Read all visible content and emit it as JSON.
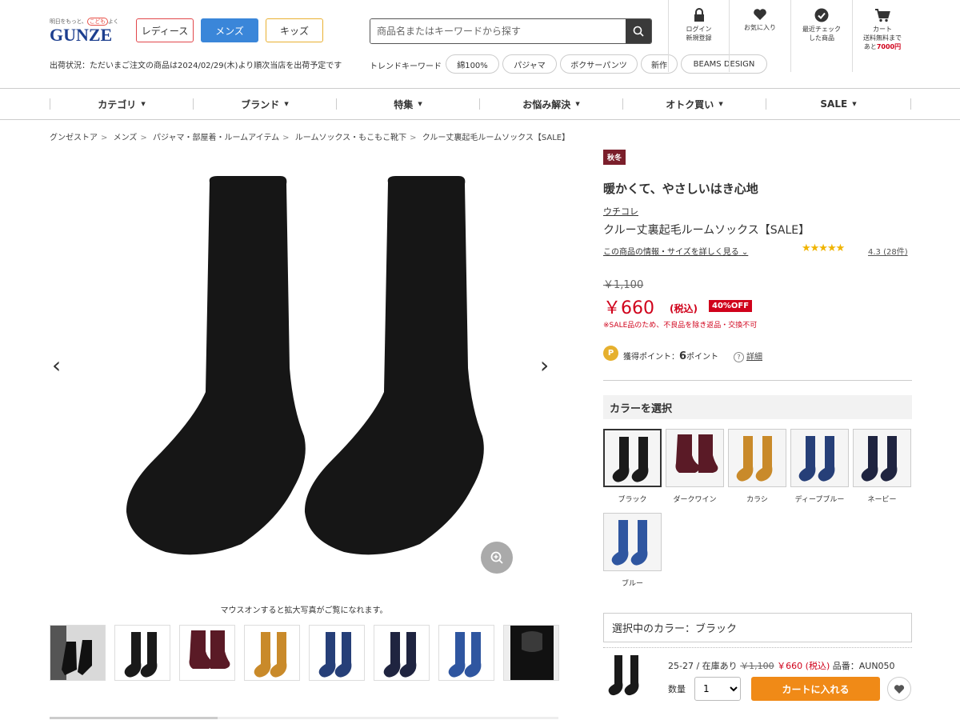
{
  "header": {
    "tagline_pre": "明日をもっと、",
    "tagline_kid": "こども",
    "tagline_post": "よく",
    "logo": "GUNZE",
    "gender_tabs": {
      "ladies": "レディース",
      "mens": "メンズ",
      "kids": "キッズ"
    },
    "ship_status": "出荷状況：ただいまご注文の商品は2024/02/29(木)より順次当店を出荷予定です",
    "search_placeholder": "商品名またはキーワードから探す",
    "trend_label": "トレンドキーワード",
    "trends": [
      "綿100%",
      "パジャマ",
      "ボクサーパンツ",
      "新作",
      "BEAMS DESIGN"
    ],
    "icons": {
      "login": {
        "line1": "ログイン",
        "line2": "新規登録"
      },
      "favorite": {
        "line1": "お気に入り"
      },
      "recent": {
        "line1": "最近チェック",
        "line2": "した商品"
      },
      "cart": {
        "line1": "カート",
        "line2": "送料無料まで",
        "line3_pre": "あと",
        "line3_amount": "7000円"
      }
    }
  },
  "nav": [
    "カテゴリ",
    "ブランド",
    "特集",
    "お悩み解決",
    "オトク買い",
    "SALE"
  ],
  "breadcrumb": [
    "グンゼストア",
    "メンズ",
    "パジャマ・部屋着・ルームアイテム",
    "ルームソックス・もこもこ靴下",
    "クルー丈裏起毛ルームソックス【SALE】"
  ],
  "gallery": {
    "zoom_note": "マウスオンすると拡大写真がご覧になれます。"
  },
  "product": {
    "season": "秋冬",
    "catch": "暖かくて、やさしいはき心地",
    "brand": "ウチコレ",
    "name": "クルー丈裏起毛ルームソックス【SALE】",
    "info_link": "この商品の情報・サイズを詳しく見る",
    "stars": "★★★★★",
    "rating": "4.3 (28件)",
    "old_price": "￥1,100",
    "price": "￥660",
    "tax_label": "(税込)",
    "discount": "40%OFF",
    "sale_note": "※SALE品のため、不良品を除き返品・交換不可",
    "points_pre": "獲得ポイント：",
    "points_num": "6",
    "points_post": "ポイント",
    "points_icon": "P",
    "detail_link": "詳細",
    "color_heading": "カラーを選択",
    "colors": [
      "ブラック",
      "ダークワイン",
      "カラシ",
      "ディープブルー",
      "ネービー",
      "ブルー"
    ],
    "selected_color": "選択中のカラー：ブラック",
    "size": "25-27",
    "stock": "在庫あり",
    "line_old_price": "￥1,100",
    "line_price": "￥660 (税込)",
    "item_code": "品番：AUN050",
    "qty_label": "数量",
    "qty_value": "1",
    "cart_button": "カートに入れる"
  },
  "colors_hex": {
    "black": "#1a1a1a",
    "dark_wine": "#5a1a26",
    "karashi": "#c98a2a",
    "deep_blue": "#263f78",
    "navy": "#1f2440",
    "blue": "#2f56a0",
    "accent_red": "#d0021b",
    "cart_orange": "#f08a17"
  }
}
